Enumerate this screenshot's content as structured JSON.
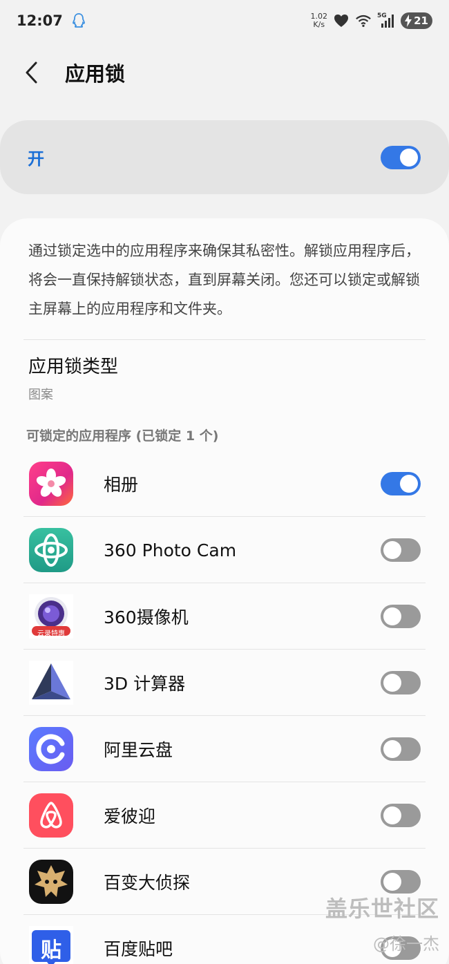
{
  "status_bar": {
    "time": "12:07",
    "net_speed_value": "1.02",
    "net_speed_unit": "K/s",
    "network": "5G",
    "battery": "21",
    "icons": [
      "qq-icon",
      "heart-icon",
      "wifi-icon",
      "signal-icon",
      "battery-charging-icon"
    ]
  },
  "header": {
    "title": "应用锁"
  },
  "master": {
    "label": "开",
    "enabled": true
  },
  "description": "通过锁定选中的应用程序来确保其私密性。解锁应用程序后，将会一直保持解锁状态，直到屏幕关闭。您还可以锁定或解锁主屏幕上的应用程序和文件夹。",
  "lock_type": {
    "title": "应用锁类型",
    "value": "图案"
  },
  "apps_section": {
    "label": "可锁定的应用程序 (已锁定 1 个)"
  },
  "apps": [
    {
      "name": "相册",
      "icon": "gallery-icon",
      "locked": true
    },
    {
      "name": "360 Photo Cam",
      "icon": "360-photo-cam-icon",
      "locked": false
    },
    {
      "name": "360摄像机",
      "icon": "360-camera-icon",
      "locked": false
    },
    {
      "name": "3D 计算器",
      "icon": "3d-calculator-icon",
      "locked": false
    },
    {
      "name": "阿里云盘",
      "icon": "aliyun-drive-icon",
      "locked": false
    },
    {
      "name": "爱彼迎",
      "icon": "airbnb-icon",
      "locked": false
    },
    {
      "name": "百变大侦探",
      "icon": "detective-icon",
      "locked": false
    },
    {
      "name": "百度贴吧",
      "icon": "baidu-tieba-icon",
      "locked": false
    }
  ],
  "badges": {
    "camera_badge": "云录特惠",
    "tieba_char": "贴"
  },
  "watermark": {
    "title": "盖乐世社区",
    "author": "@徐一杰"
  },
  "colors": {
    "accent": "#3478e6",
    "toggle_off": "#9a9a9a",
    "master_label": "#1b6fd6"
  }
}
